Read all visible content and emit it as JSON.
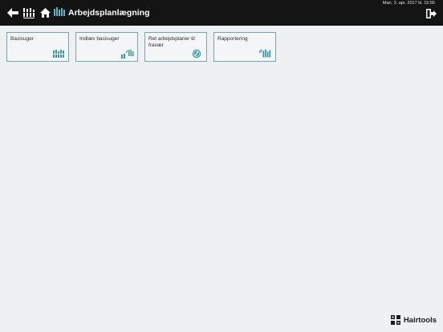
{
  "header": {
    "title": "Arbejdsplanlægning",
    "datetime": "Man. 3. apr. 2017 kl. 15:55",
    "icons": [
      "back-arrow-icon",
      "planner-icon",
      "home-icon",
      "work-plan-icon",
      "logout-icon"
    ]
  },
  "tiles": [
    {
      "label": "Basisuger",
      "icon": "basic-weeks-icon"
    },
    {
      "label": "Indlæs basisuger",
      "icon": "load-weeks-icon"
    },
    {
      "label": "Ret arbejdsplaner til fravær",
      "icon": "absence-icon"
    },
    {
      "label": "Rapportering",
      "icon": "report-icon"
    }
  ],
  "brand": {
    "name": "Hairtools"
  },
  "colors": {
    "topbar": "#141414",
    "accent": "#6fa8ad",
    "background": "#eef0f1"
  }
}
